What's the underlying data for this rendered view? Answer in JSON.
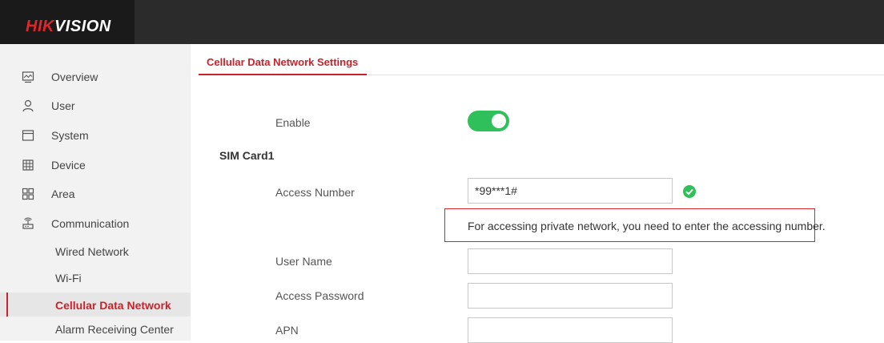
{
  "brand": {
    "logo_red": "HIK",
    "logo_white": "VISION"
  },
  "sidebar": {
    "items": [
      {
        "label": "Overview",
        "icon": "monitor-icon"
      },
      {
        "label": "User",
        "icon": "user-icon"
      },
      {
        "label": "System",
        "icon": "window-icon"
      },
      {
        "label": "Device",
        "icon": "device-grid-icon"
      },
      {
        "label": "Area",
        "icon": "area-grid-icon"
      },
      {
        "label": "Communication",
        "icon": "router-icon"
      }
    ],
    "sub_items": [
      {
        "label": "Wired Network"
      },
      {
        "label": "Wi-Fi"
      },
      {
        "label": "Cellular Data Network",
        "active": true
      },
      {
        "label": "Alarm Receiving Center"
      }
    ]
  },
  "tab": {
    "label": "Cellular Data Network Settings"
  },
  "form": {
    "enable_label": "Enable",
    "enable_on": true,
    "section_title": "SIM Card1",
    "access_number_label": "Access Number",
    "access_number_value": "*99***1#",
    "hint": "For accessing private network, you need to enter the accessing number.",
    "user_name_label": "User Name",
    "user_name_value": "",
    "access_password_label": "Access Password",
    "access_password_value": "",
    "apn_label": "APN",
    "apn_value": ""
  },
  "colors": {
    "accent": "#c8232c",
    "toggle_on": "#2fbf5b",
    "check": "#2fbf5b",
    "topbar": "#2b2b2b",
    "sidebar_bg": "#f2f2f2"
  }
}
